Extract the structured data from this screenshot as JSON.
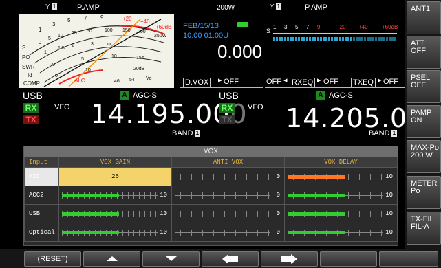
{
  "left": {
    "ant_label": "Y",
    "ant_num": "1",
    "pamp": "P.AMP",
    "power": "200W",
    "date": "FEB/15/13",
    "time": "10:00 01:00U",
    "offset": "0.000",
    "dvox": "D.VOX",
    "dvox_state": "OFF",
    "mode": "USB",
    "vfo": "VFO",
    "agc_tag": "A",
    "agc": "AGC-S",
    "rx": "RX",
    "tx": "TX",
    "freq_main": "14.195.00",
    "freq_last": "0",
    "band_label": "BAND",
    "band_num": "1",
    "meter_scale": {
      "s_marks": [
        "1",
        "3",
        "5",
        "7",
        "9",
        "+20",
        "+40",
        "+60dB"
      ],
      "po_marks": [
        "0",
        "5",
        "10",
        "25",
        "50",
        "100",
        "150",
        "200",
        "250W"
      ],
      "swr_marks": [
        "1",
        "1.5",
        "2",
        "3",
        "∞"
      ],
      "id_marks": [
        "0",
        "5",
        "10",
        "15A"
      ],
      "comp_marks": [
        "0",
        "10",
        "20dB"
      ],
      "alc_label": "ALC",
      "vd_marks": [
        "46",
        "54",
        "Vd"
      ],
      "labels": [
        "S",
        "PO",
        "SWR",
        "Id",
        "COMP"
      ]
    }
  },
  "right": {
    "ant_label": "Y",
    "ant_num": "1",
    "pamp": "P.AMP",
    "s_scale": [
      "S",
      "1",
      "3",
      "5",
      "7",
      "9",
      "+20",
      "+40",
      "+60dB"
    ],
    "off1": "OFF",
    "rxeq": "RXEQ",
    "rxeq_state": "OFF",
    "txeq": "TXEQ",
    "txeq_state": "OFF",
    "mode": "USB",
    "vfo": "VFO",
    "agc_tag": "A",
    "agc": "AGC-S",
    "rx": "RX",
    "tx": "TX",
    "freq_main": "14.205.00",
    "freq_last": "0",
    "band_label": "BAND",
    "band_num": "1"
  },
  "vox": {
    "title": "VOX",
    "headers": [
      "Input",
      "VOX GAIN",
      "ANTI VOX",
      "VOX DELAY"
    ],
    "rows": [
      {
        "input": "MIC",
        "gain": "26",
        "anti": "0",
        "delay": "10",
        "gain_level": 0,
        "anti_level": 0,
        "delay_level": 0.6,
        "selected": true
      },
      {
        "input": "ACC2",
        "gain": "10",
        "anti": "0",
        "delay": "10",
        "gain_level": 0.6,
        "anti_level": 0,
        "delay_level": 0.6,
        "selected": false
      },
      {
        "input": "USB",
        "gain": "10",
        "anti": "0",
        "delay": "10",
        "gain_level": 0.6,
        "anti_level": 0,
        "delay_level": 0.6,
        "selected": false
      },
      {
        "input": "Optical",
        "gain": "10",
        "anti": "0",
        "delay": "10",
        "gain_level": 0.6,
        "anti_level": 0,
        "delay_level": 0.6,
        "selected": false
      }
    ]
  },
  "side_buttons": [
    {
      "l1": "ANT1",
      "l2": ""
    },
    {
      "l1": "ATT",
      "l2": "OFF"
    },
    {
      "l1": "PSEL",
      "l2": "OFF"
    },
    {
      "l1": "PAMP",
      "l2": "ON"
    },
    {
      "l1": "MAX-Po",
      "l2": "200 W"
    },
    {
      "l1": "METER",
      "l2": "Po"
    },
    {
      "l1": "TX-FIL",
      "l2": "FIL-A"
    }
  ],
  "bottom_buttons": [
    "(RESET)",
    "up-arrow",
    "down-arrow",
    "left-arrow",
    "right-arrow",
    "",
    ""
  ],
  "colors": {
    "green": "#33cc33",
    "orange": "#ff7722",
    "gain_cell": "#f3d36a",
    "selected_input": "#e8e8e8"
  }
}
